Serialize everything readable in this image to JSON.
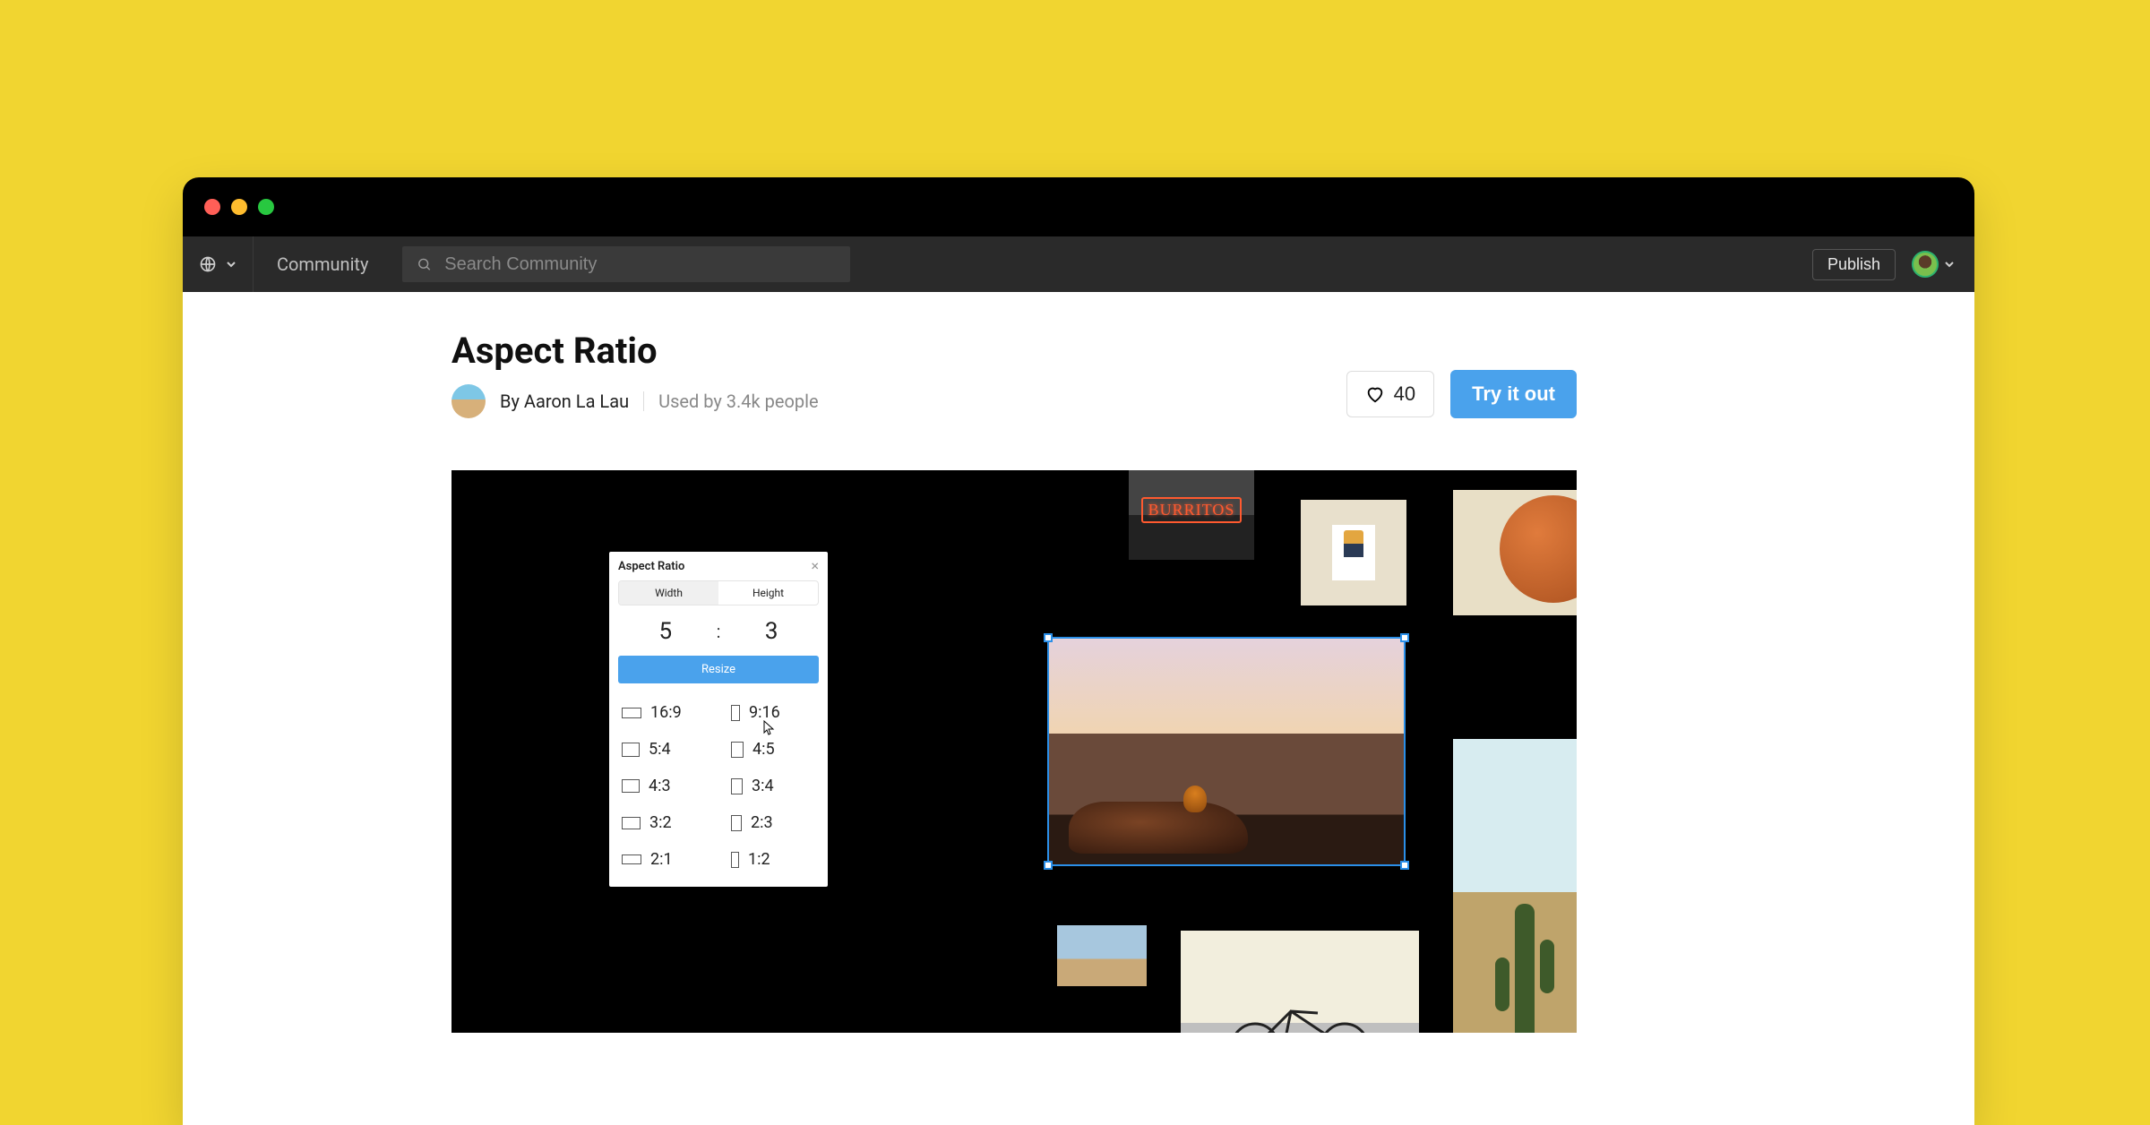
{
  "toolbar": {
    "tab": "Community",
    "search_placeholder": "Search Community",
    "publish": "Publish"
  },
  "page": {
    "title": "Aspect Ratio",
    "by_prefix": "By ",
    "author": "Aaron La Lau",
    "usage": "Used by 3.4k people",
    "likes": "40",
    "try": "Try it out"
  },
  "panel": {
    "title": "Aspect Ratio",
    "tab_width": "Width",
    "tab_height": "Height",
    "w": "5",
    "h": "3",
    "colon": ":",
    "resize": "Resize",
    "presets": [
      [
        "16:9",
        "9:16"
      ],
      [
        "5:4",
        "4:5"
      ],
      [
        "4:3",
        "3:4"
      ],
      [
        "3:2",
        "2:3"
      ],
      [
        "2:1",
        "1:2"
      ]
    ]
  },
  "canvas": {
    "neon_text": "BURRITOS"
  }
}
